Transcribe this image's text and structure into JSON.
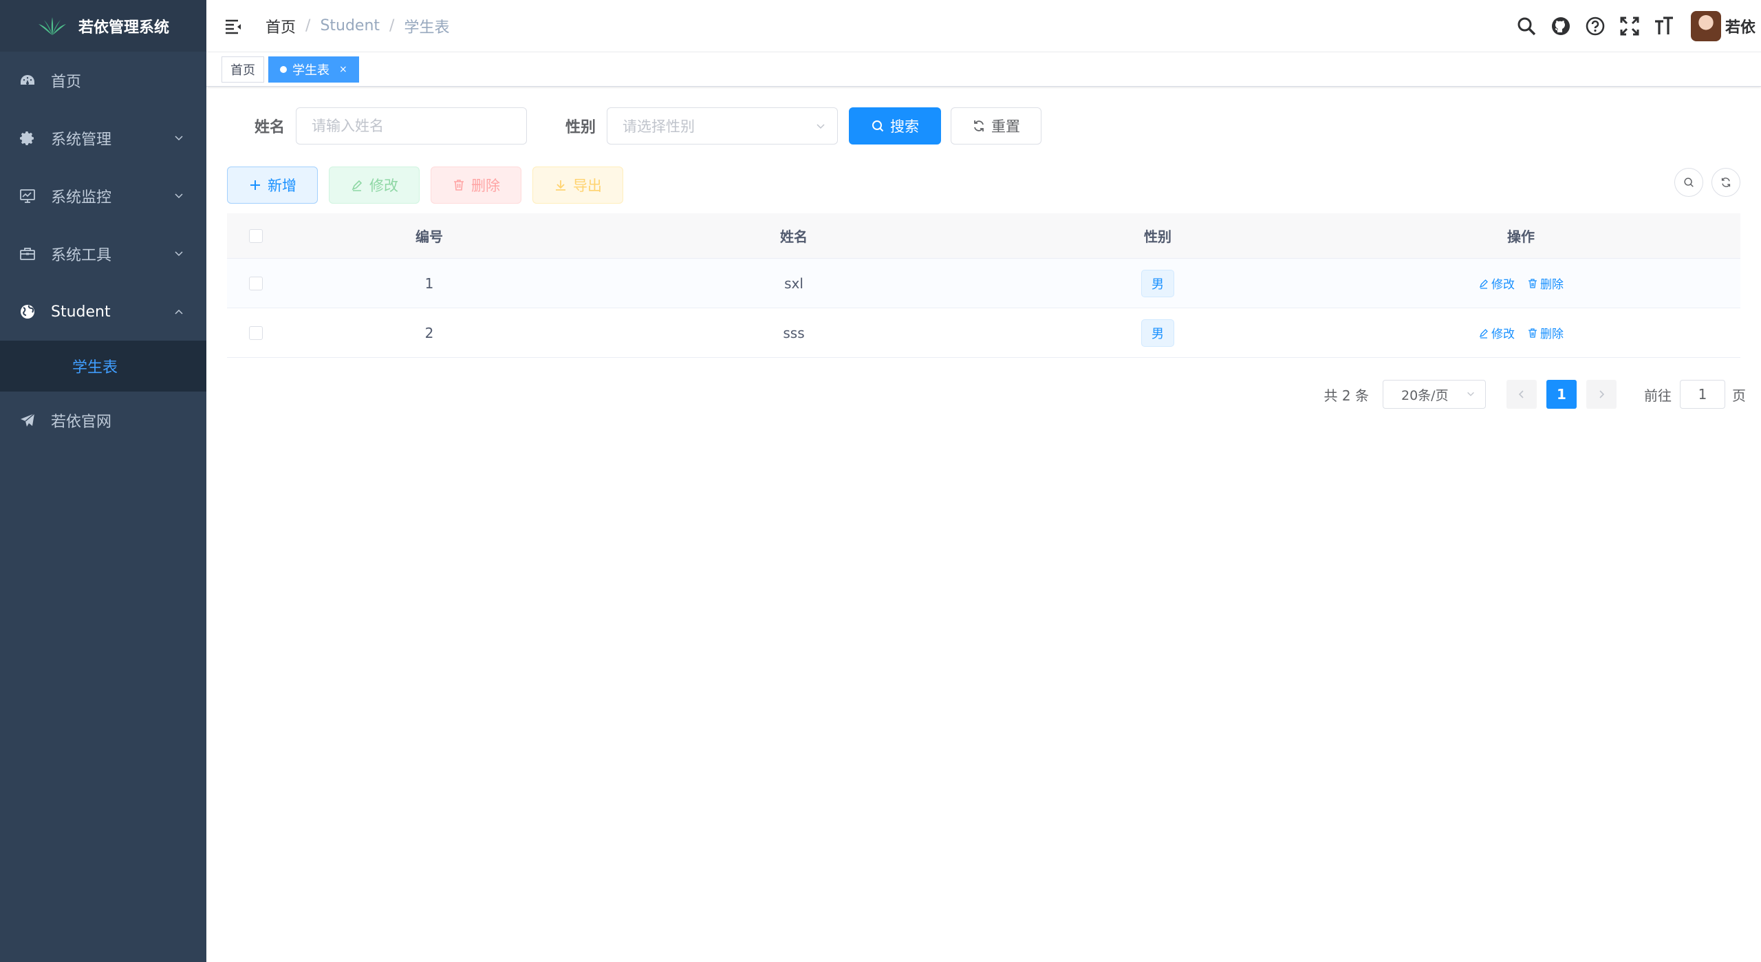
{
  "sidebar": {
    "app_title": "若依管理系统",
    "menu": [
      {
        "label": "首页",
        "icon": "dashboard-icon"
      },
      {
        "label": "系统管理",
        "icon": "gear-icon"
      },
      {
        "label": "系统监控",
        "icon": "monitor-icon"
      },
      {
        "label": "系统工具",
        "icon": "toolbox-icon"
      },
      {
        "label": "Student",
        "icon": "globe-icon"
      },
      {
        "label": "若依官网",
        "icon": "paper-plane-icon"
      }
    ],
    "submenu": [
      {
        "label": "学生表"
      }
    ]
  },
  "navbar": {
    "breadcrumb": [
      "首页",
      "Student",
      "学生表"
    ],
    "separator": "/",
    "username": "若依"
  },
  "tags": [
    {
      "label": "首页",
      "active": false
    },
    {
      "label": "学生表",
      "active": true,
      "close": "×"
    }
  ],
  "search": {
    "name_label": "姓名",
    "name_placeholder": "请输入姓名",
    "sex_label": "性别",
    "sex_placeholder": "请选择性别",
    "search_button": "搜索",
    "reset_button": "重置"
  },
  "toolbar": {
    "add": "新增",
    "edit": "修改",
    "delete": "删除",
    "export": "导出"
  },
  "table": {
    "headers": [
      "编号",
      "姓名",
      "性别",
      "操作"
    ],
    "rows": [
      {
        "id": "1",
        "name": "sxl",
        "sex": "男",
        "edit": "修改",
        "delete": "删除"
      },
      {
        "id": "2",
        "name": "sss",
        "sex": "男",
        "edit": "修改",
        "delete": "删除"
      }
    ]
  },
  "pagination": {
    "total": "共 2 条",
    "page_size": "20条/页",
    "current_page": "1",
    "goto_label": "前往",
    "goto_value": "1",
    "page_suffix": "页"
  },
  "colors": {
    "sidebar_bg": "#304156",
    "primary": "#1890ff",
    "active_submenu_text": "#409eff"
  }
}
